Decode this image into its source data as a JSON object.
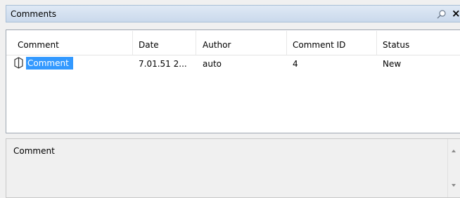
{
  "panel": {
    "title": "Comments",
    "pin_icon": "pin-icon",
    "close_label": "×"
  },
  "table": {
    "columns": [
      "Comment",
      "Date",
      "Author",
      "Comment ID",
      "Status"
    ],
    "rows": [
      {
        "comment": "Comment",
        "comment_icon": "comment-marker-icon",
        "date": "7.01.51 2...",
        "author": "auto",
        "comment_id": "4",
        "status": "New"
      }
    ]
  },
  "detail": {
    "label": "Comment"
  },
  "colors": {
    "selection": "#3399ff",
    "titlebar": "#d4e1f1"
  }
}
